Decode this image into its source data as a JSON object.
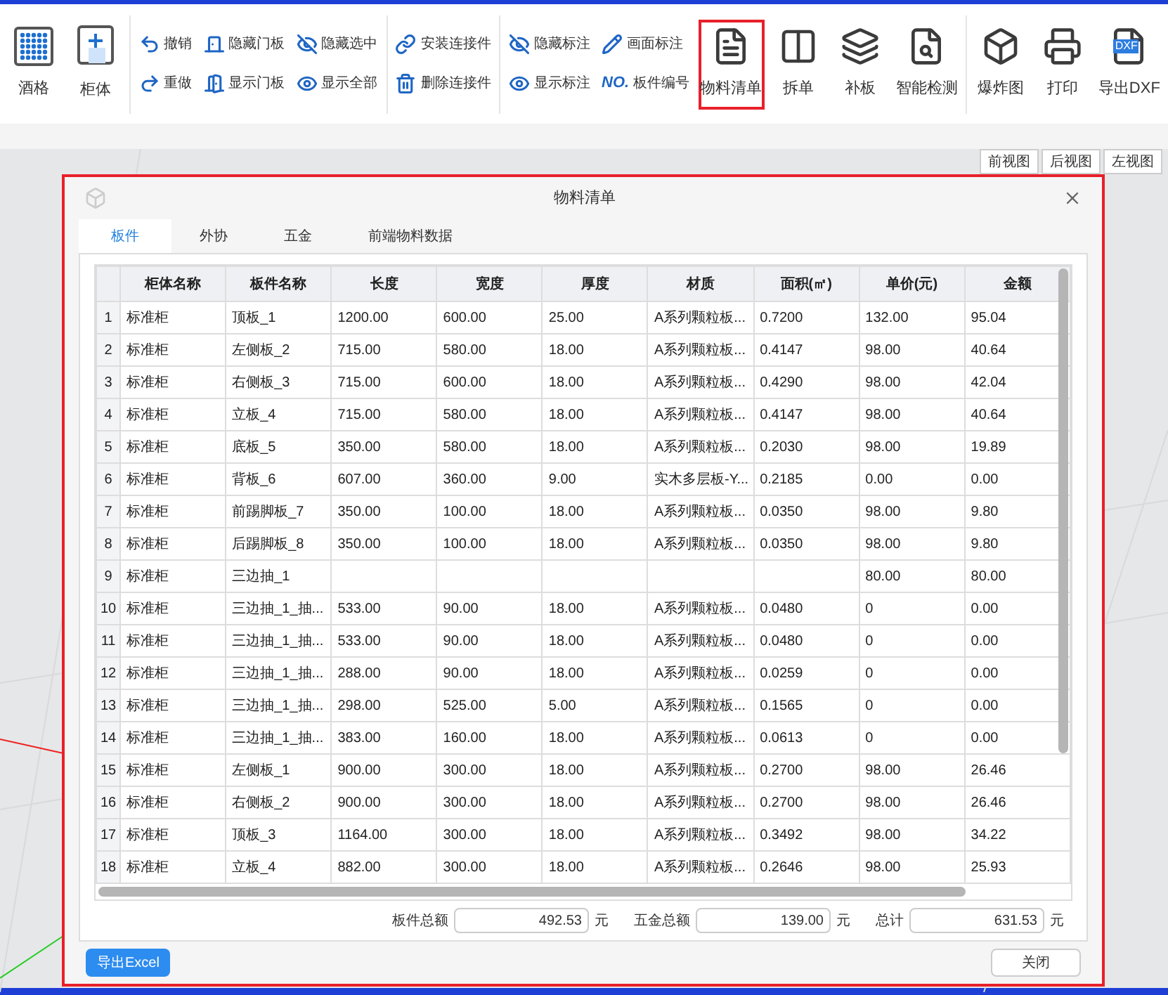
{
  "toolbar": [
    {
      "kind": "large",
      "label": "酒格",
      "highlighted": false
    },
    {
      "kind": "large",
      "label": "柜体",
      "highlighted": false
    },
    {
      "kind": "sep"
    },
    {
      "kind": "pair",
      "items": [
        "撤销",
        "重做"
      ]
    },
    {
      "kind": "pair",
      "items": [
        "隐藏门板",
        "显示门板"
      ]
    },
    {
      "kind": "pair",
      "items": [
        "隐藏选中",
        "显示全部"
      ]
    },
    {
      "kind": "sep"
    },
    {
      "kind": "pair",
      "items": [
        "安装连接件",
        "删除连接件"
      ]
    },
    {
      "kind": "sep"
    },
    {
      "kind": "pair",
      "items": [
        "隐藏标注",
        "显示标注"
      ]
    },
    {
      "kind": "pair",
      "items": [
        "画面标注",
        "板件编号"
      ],
      "badge": "NO."
    },
    {
      "kind": "large",
      "label": "物料清单",
      "highlighted": true
    },
    {
      "kind": "large",
      "label": "拆单",
      "highlighted": false
    },
    {
      "kind": "large",
      "label": "补板",
      "highlighted": false
    },
    {
      "kind": "large",
      "label": "智能检测",
      "highlighted": false
    },
    {
      "kind": "sep"
    },
    {
      "kind": "large",
      "label": "爆炸图",
      "highlighted": false
    },
    {
      "kind": "large",
      "label": "打印",
      "highlighted": false
    },
    {
      "kind": "large",
      "label": "导出DXF",
      "highlighted": false,
      "badge": "DXF"
    }
  ],
  "view_tabs": [
    "前视图",
    "后视图",
    "左视图"
  ],
  "dialog": {
    "title": "物料清单",
    "tabs": [
      {
        "label": "板件",
        "selected": true
      },
      {
        "label": "外协",
        "selected": false
      },
      {
        "label": "五金",
        "selected": false
      },
      {
        "label": "前端物料数据",
        "selected": false
      }
    ],
    "table": {
      "columns": [
        "柜体名称",
        "板件名称",
        "长度",
        "宽度",
        "厚度",
        "材质",
        "面积(㎡)",
        "单价(元)",
        "金额"
      ],
      "rows": [
        {
          "index": "1",
          "cells": [
            "标准柜",
            "顶板_1",
            "1200.00",
            "600.00",
            "25.00",
            "A系列颗粒板...",
            "0.7200",
            "132.00",
            "95.04"
          ]
        },
        {
          "index": "2",
          "cells": [
            "标准柜",
            "左侧板_2",
            "715.00",
            "580.00",
            "18.00",
            "A系列颗粒板...",
            "0.4147",
            "98.00",
            "40.64"
          ]
        },
        {
          "index": "3",
          "cells": [
            "标准柜",
            "右侧板_3",
            "715.00",
            "600.00",
            "18.00",
            "A系列颗粒板...",
            "0.4290",
            "98.00",
            "42.04"
          ]
        },
        {
          "index": "4",
          "cells": [
            "标准柜",
            "立板_4",
            "715.00",
            "580.00",
            "18.00",
            "A系列颗粒板...",
            "0.4147",
            "98.00",
            "40.64"
          ]
        },
        {
          "index": "5",
          "cells": [
            "标准柜",
            "底板_5",
            "350.00",
            "580.00",
            "18.00",
            "A系列颗粒板...",
            "0.2030",
            "98.00",
            "19.89"
          ]
        },
        {
          "index": "6",
          "cells": [
            "标准柜",
            "背板_6",
            "607.00",
            "360.00",
            "9.00",
            "实木多层板-Y...",
            "0.2185",
            "0.00",
            "0.00"
          ]
        },
        {
          "index": "7",
          "cells": [
            "标准柜",
            "前踢脚板_7",
            "350.00",
            "100.00",
            "18.00",
            "A系列颗粒板...",
            "0.0350",
            "98.00",
            "9.80"
          ]
        },
        {
          "index": "8",
          "cells": [
            "标准柜",
            "后踢脚板_8",
            "350.00",
            "100.00",
            "18.00",
            "A系列颗粒板...",
            "0.0350",
            "98.00",
            "9.80"
          ]
        },
        {
          "index": "9",
          "cells": [
            "标准柜",
            "三边抽_1",
            "",
            "",
            "",
            "",
            "",
            "80.00",
            "80.00"
          ]
        },
        {
          "index": "10",
          "cells": [
            "标准柜",
            "三边抽_1_抽...",
            "533.00",
            "90.00",
            "18.00",
            "A系列颗粒板...",
            "0.0480",
            "0",
            "0.00"
          ]
        },
        {
          "index": "11",
          "cells": [
            "标准柜",
            "三边抽_1_抽...",
            "533.00",
            "90.00",
            "18.00",
            "A系列颗粒板...",
            "0.0480",
            "0",
            "0.00"
          ]
        },
        {
          "index": "12",
          "cells": [
            "标准柜",
            "三边抽_1_抽...",
            "288.00",
            "90.00",
            "18.00",
            "A系列颗粒板...",
            "0.0259",
            "0",
            "0.00"
          ]
        },
        {
          "index": "13",
          "cells": [
            "标准柜",
            "三边抽_1_抽...",
            "298.00",
            "525.00",
            "5.00",
            "A系列颗粒板...",
            "0.1565",
            "0",
            "0.00"
          ]
        },
        {
          "index": "14",
          "cells": [
            "标准柜",
            "三边抽_1_抽...",
            "383.00",
            "160.00",
            "18.00",
            "A系列颗粒板...",
            "0.0613",
            "0",
            "0.00"
          ]
        },
        {
          "index": "15",
          "cells": [
            "标准柜",
            "左侧板_1",
            "900.00",
            "300.00",
            "18.00",
            "A系列颗粒板...",
            "0.2700",
            "98.00",
            "26.46"
          ]
        },
        {
          "index": "16",
          "cells": [
            "标准柜",
            "右侧板_2",
            "900.00",
            "300.00",
            "18.00",
            "A系列颗粒板...",
            "0.2700",
            "98.00",
            "26.46"
          ]
        },
        {
          "index": "17",
          "cells": [
            "标准柜",
            "顶板_3",
            "1164.00",
            "300.00",
            "18.00",
            "A系列颗粒板...",
            "0.3492",
            "98.00",
            "34.22"
          ]
        },
        {
          "index": "18",
          "cells": [
            "标准柜",
            "立板_4",
            "882.00",
            "300.00",
            "18.00",
            "A系列颗粒板...",
            "0.2646",
            "98.00",
            "25.93"
          ]
        }
      ]
    },
    "totals": [
      {
        "label": "板件总额",
        "value": "492.53",
        "unit": "元"
      },
      {
        "label": "五金总额",
        "value": "139.00",
        "unit": "元"
      },
      {
        "label": "总计",
        "value": "631.53",
        "unit": "元"
      }
    ],
    "export_button": "导出Excel",
    "close_button": "关闭"
  }
}
